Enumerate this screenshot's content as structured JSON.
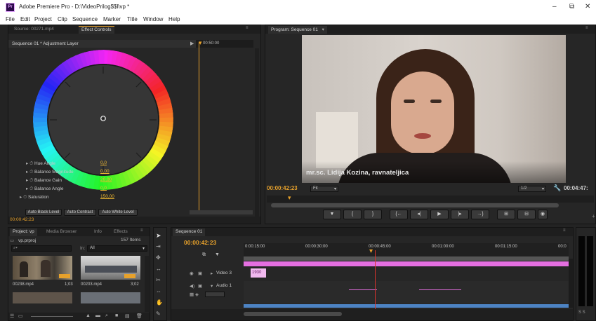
{
  "window": {
    "title": "Adobe Premiere Pro - D:\\VideoPrilog$$l\\vp *",
    "app_icon": "Pr",
    "controls": [
      "–",
      "⧉",
      "✕"
    ]
  },
  "menu": [
    "File",
    "Edit",
    "Project",
    "Clip",
    "Sequence",
    "Marker",
    "Title",
    "Window",
    "Help"
  ],
  "source_panel": {
    "tabs": [
      "Source: 00271.mp4",
      "Effect Controls"
    ],
    "sequence_label": "Sequence 01 * Adjustment Layer",
    "ruler_time": "00:50:00",
    "params": [
      {
        "label": "Hue Angle",
        "value": "0,0"
      },
      {
        "label": "Balance Magnitude",
        "value": "0,00"
      },
      {
        "label": "Balance Gain",
        "value": "20,00"
      },
      {
        "label": "Balance Angle",
        "value": "0,0"
      },
      {
        "label": "Saturation",
        "value": "150,00"
      }
    ],
    "auto_buttons": [
      "Auto Black Level",
      "Auto Contrast",
      "Auto White Level"
    ],
    "timecode": "00:00:42:23"
  },
  "program_panel": {
    "tab": "Program: Sequence 01",
    "lower_third": "mr.sc. Lidija Kozina, ravnateljica",
    "timecode": "00:00:42:23",
    "fit": "Fit",
    "resolution": "1/2",
    "duration": "00:04:47:",
    "transport": [
      "▼",
      "{",
      "}",
      "{←",
      "◂|",
      "▶",
      "|▸",
      "→}",
      "⊞",
      "⊟",
      "◉"
    ]
  },
  "project_panel": {
    "tabs": [
      "Project: vp",
      "Media Browser",
      "Info",
      "Effects"
    ],
    "project_file": "vp.prproj",
    "item_count": "157 Items",
    "search_placeholder": "",
    "in_label": "In:",
    "in_value": "All",
    "clips": [
      {
        "name": "00238.mp4",
        "duration": "1;03"
      },
      {
        "name": "00203.mp4",
        "duration": "3;02"
      }
    ]
  },
  "timeline_panel": {
    "tab": "Sequence 01",
    "timecode": "00:00:42:23",
    "ruler": [
      "0:00:15:00",
      "00:00:30:00",
      "00:00:45:00",
      "00:01:00:00",
      "00:01:15:00",
      "00:0"
    ],
    "tracks": [
      {
        "name": "Video 3",
        "clip": "1930"
      },
      {
        "name": "Audio 1",
        "clip": ""
      }
    ]
  },
  "colors": {
    "accent_orange": "#e7a12b",
    "playhead_red": "#d8332d",
    "clip_pink": "#e46fe0",
    "audio_clip": "#4d83c3",
    "panel_bg": "#262626"
  }
}
